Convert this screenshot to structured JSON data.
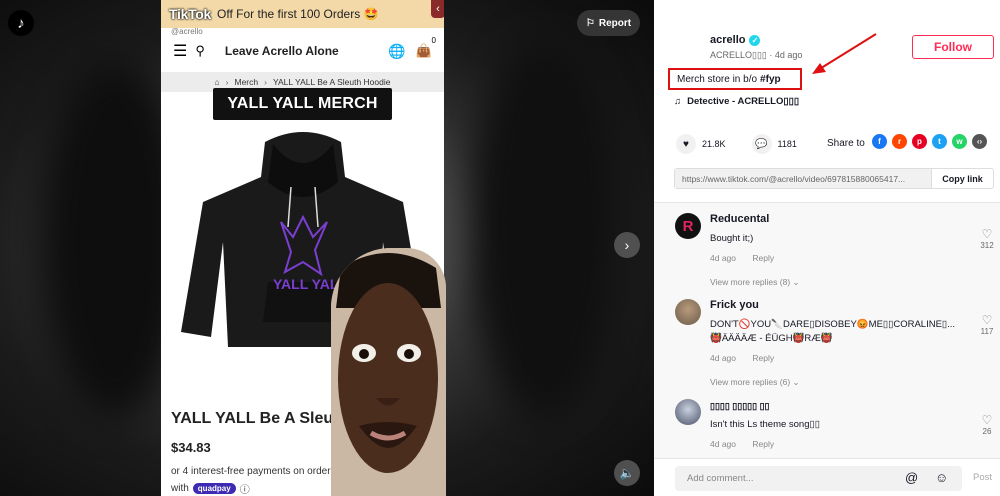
{
  "video": {
    "report_label": "Report",
    "phone": {
      "tiktok_watermark": "TikTok",
      "promo_text": "Off For the first 100 Orders",
      "promo_emoji": "🤩",
      "store_name": "Leave Acrello Alone",
      "bag_count": "0",
      "breadcrumb": {
        "home": "⌂",
        "merch": "Merch",
        "product": "YALL YALL Be A Sleuth Hoodie"
      },
      "banner": "YALL YALL MERCH",
      "product_title": "YALL YALL Be A Sleuth",
      "price": "$34.83",
      "installments_line1": "or 4 interest-free payments on orders",
      "installments_with": "with",
      "quadpay": "quadpay"
    }
  },
  "author": {
    "name": "acrello",
    "subtitle": "ACRELLO▯▯▯ · 4d ago",
    "follow_label": "Follow"
  },
  "description": {
    "text": "Merch store in b/o",
    "hashtag": "#fyp"
  },
  "music": {
    "icon": "♫",
    "title": "Detective - ACRELLO▯▯▯"
  },
  "stats": {
    "likes": "21.8K",
    "comments": "1181"
  },
  "share": {
    "label": "Share to",
    "targets": [
      {
        "name": "facebook",
        "color": "#1877f2",
        "glyph": "f"
      },
      {
        "name": "reddit",
        "color": "#ff4500",
        "glyph": "r"
      },
      {
        "name": "pinterest",
        "color": "#e60023",
        "glyph": "p"
      },
      {
        "name": "twitter",
        "color": "#1da1f2",
        "glyph": "t"
      },
      {
        "name": "whatsapp",
        "color": "#25d366",
        "glyph": "w"
      },
      {
        "name": "embed",
        "color": "#555555",
        "glyph": "‹›"
      }
    ]
  },
  "link": {
    "url": "https://www.tiktok.com/@acrello/video/697815880065417...",
    "copy_label": "Copy link"
  },
  "comments": [
    {
      "user": "Reducental",
      "text": "Bought it;)",
      "time": "4d ago",
      "reply": "Reply",
      "likes": "312",
      "view_replies": "View more replies (8)"
    },
    {
      "user": "Frick you",
      "text": "DON'T🚫YOU🔪DARE▯DISOBEY😡ME▯▯CORALINE▯...",
      "text2": "👹ÄÄÄÄÆ - ÉÜGH👹RÆ👹",
      "time": "4d ago",
      "reply": "Reply",
      "likes": "117",
      "view_replies": "View more replies (6)"
    },
    {
      "user": "▯▯▯▯ ▯▯▯▯▯ ▯▯",
      "text": "Isn't this Ls theme song▯▯",
      "time": "4d ago",
      "reply": "Reply",
      "likes": "26"
    }
  ],
  "comment_bar": {
    "placeholder": "Add comment...",
    "post_label": "Post"
  }
}
